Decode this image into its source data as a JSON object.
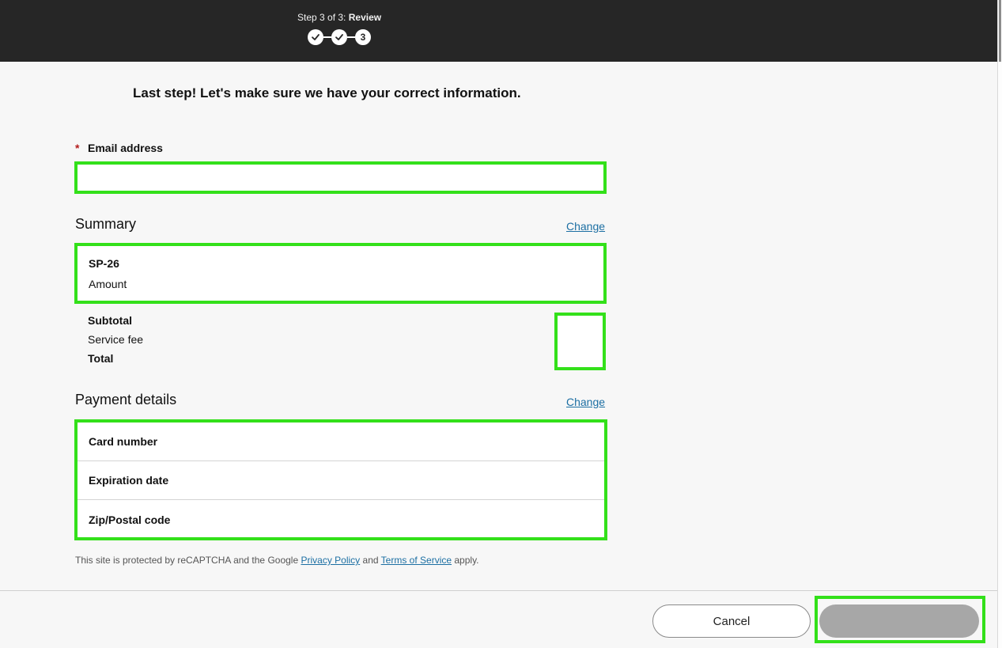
{
  "header": {
    "step_prefix": "Step 3 of 3:",
    "step_name": "Review",
    "steps": [
      {
        "state": "done",
        "icon": "check-icon"
      },
      {
        "state": "done",
        "icon": "check-icon"
      },
      {
        "state": "current",
        "label": "3"
      }
    ]
  },
  "main": {
    "headline": "Last step! Let's make sure we have your correct information.",
    "email": {
      "required_marker": "*",
      "label": "Email address",
      "value": "",
      "placeholder": ""
    },
    "summary": {
      "title": "Summary",
      "change_label": "Change",
      "item_code": "SP-26",
      "item_amount_label": "Amount",
      "subtotal_label": "Subtotal",
      "service_fee_label": "Service fee",
      "total_label": "Total"
    },
    "payment": {
      "title": "Payment details",
      "change_label": "Change",
      "rows": [
        {
          "label": "Card number"
        },
        {
          "label": "Expiration date"
        },
        {
          "label": "Zip/Postal code"
        }
      ]
    },
    "recaptcha": {
      "prefix": "This site is protected by reCAPTCHA and the Google",
      "privacy_link": "Privacy Policy",
      "middle": "and",
      "terms_link": "Terms of Service",
      "suffix": "apply."
    }
  },
  "footer": {
    "cancel_label": "Cancel",
    "submit_label": ""
  },
  "colors": {
    "highlight": "#33e01a",
    "header_bg": "#262626",
    "link": "#1c6fa3",
    "required": "#b31b1b",
    "disabled_button": "#a7a7a7"
  }
}
